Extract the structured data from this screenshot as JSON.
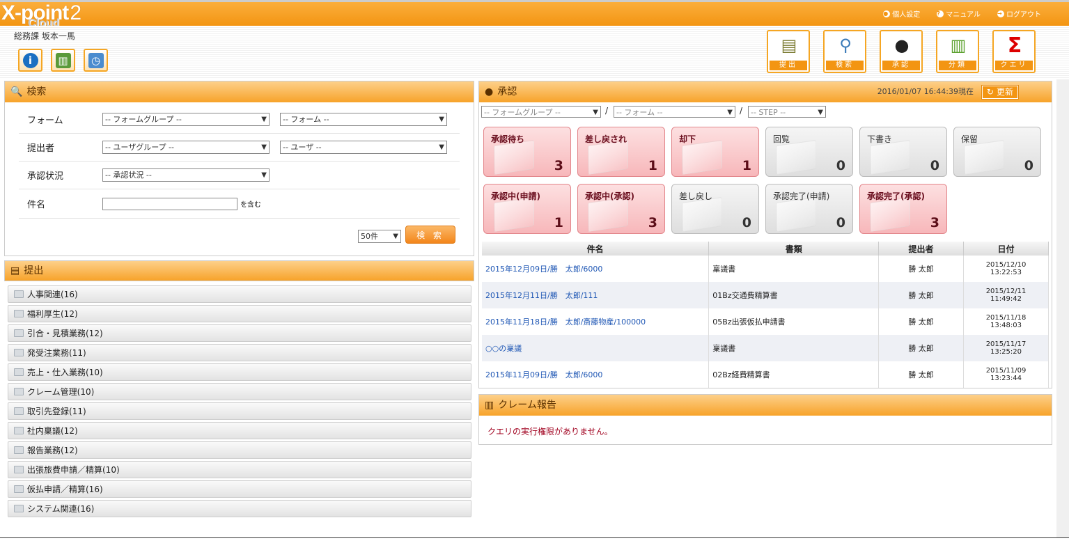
{
  "header": {
    "logo": "X-point",
    "logo_version": "2",
    "logo_sub": "Cloud",
    "links": [
      "個人設定",
      "マニュアル",
      "ログアウト"
    ],
    "user": "総務課  坂本一馬",
    "nav_buttons": [
      "提出",
      "検索",
      "承認",
      "分類",
      "クエリ"
    ]
  },
  "search": {
    "title": "検索",
    "rows": [
      {
        "label": "フォーム",
        "sel1": "-- フォームグループ --",
        "sel2": "-- フォーム --"
      },
      {
        "label": "提出者",
        "sel1": "-- ユーザグループ --",
        "sel2": "-- ユーザ --"
      },
      {
        "label": "承認状況",
        "sel1": "-- 承認状況 --"
      },
      {
        "label": "件名",
        "suffix": "を含む"
      }
    ],
    "count": "50件",
    "button": "検 索"
  },
  "submit": {
    "title": "提出",
    "items": [
      "人事関連(16)",
      "福利厚生(12)",
      "引合・見積業務(12)",
      "発受注業務(11)",
      "売上・仕入業務(10)",
      "クレーム管理(10)",
      "取引先登録(11)",
      "社内稟議(12)",
      "報告業務(12)",
      "出張旅費申請／精算(10)",
      "仮払申請／精算(16)",
      "システム関連(16)"
    ]
  },
  "approval": {
    "title": "承認",
    "timestamp": "2016/01/07 16:44:39現在",
    "refresh": "更新",
    "filters": [
      "-- フォームグループ --",
      "-- フォーム --",
      "-- STEP --"
    ],
    "tiles_row1": [
      {
        "name": "承認待ち",
        "count": "3",
        "hl": true
      },
      {
        "name": "差し戻され",
        "count": "1",
        "hl": true
      },
      {
        "name": "却下",
        "count": "1",
        "hl": true
      },
      {
        "name": "回覧",
        "count": "0",
        "hl": false
      },
      {
        "name": "下書き",
        "count": "0",
        "hl": false
      },
      {
        "name": "保留",
        "count": "0",
        "hl": false
      }
    ],
    "tiles_row2": [
      {
        "name": "承認中(申請)",
        "count": "1",
        "hl": true
      },
      {
        "name": "承認中(承認)",
        "count": "3",
        "hl": true
      },
      {
        "name": "差し戻し",
        "count": "0",
        "hl": false
      },
      {
        "name": "承認完了(申請)",
        "count": "0",
        "hl": false
      },
      {
        "name": "承認完了(承認)",
        "count": "3",
        "hl": true
      }
    ],
    "columns": [
      "件名",
      "書類",
      "提出者",
      "日付"
    ],
    "rows": [
      {
        "subject": "2015年12月09日/勝　太郎/6000",
        "doc": "稟議書",
        "by": "勝 太郎",
        "date": "2015/12/10",
        "time": "13:22:53"
      },
      {
        "subject": "2015年12月11日/勝　太郎/111",
        "doc": "01Bz交通費精算書",
        "by": "勝 太郎",
        "date": "2015/12/11",
        "time": "11:49:42"
      },
      {
        "subject": "2015年11月18日/勝　太郎/斎藤物産/100000",
        "doc": "05Bz出張仮払申請書",
        "by": "勝 太郎",
        "date": "2015/11/18",
        "time": "13:48:03"
      },
      {
        "subject": "○○の稟議",
        "doc": "稟議書",
        "by": "勝 太郎",
        "date": "2015/11/17",
        "time": "13:25:20"
      },
      {
        "subject": "2015年11月09日/勝　太郎/6000",
        "doc": "02Bz経費精算書",
        "by": "勝 太郎",
        "date": "2015/11/09",
        "time": "13:23:44"
      }
    ]
  },
  "claim": {
    "title": "クレーム報告",
    "message": "クエリの実行権限がありません。"
  },
  "colors": {
    "accent": "#f39512",
    "tile_red": "#f7b7ba",
    "link": "#1e56b4"
  }
}
